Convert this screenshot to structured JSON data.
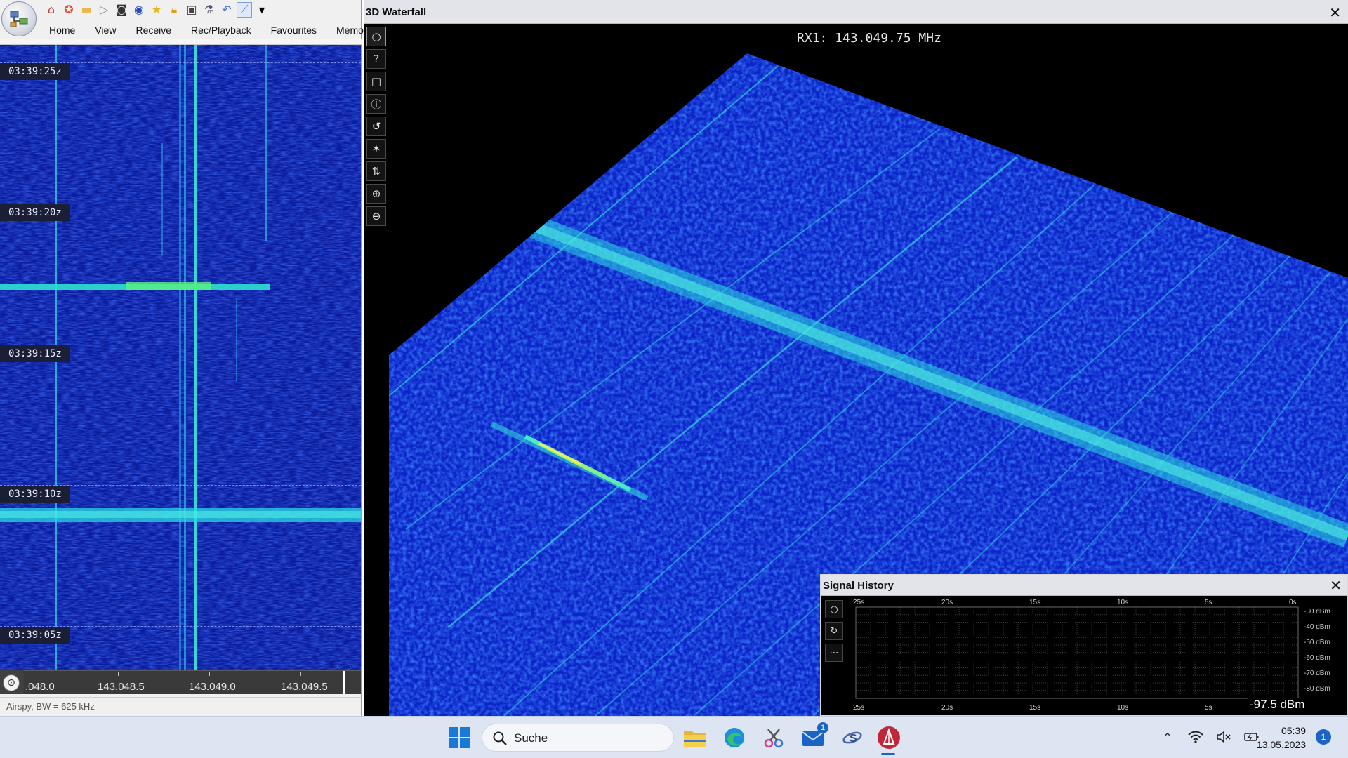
{
  "left_app": {
    "toolbar_icons": [
      "home-icon",
      "help-ring-icon",
      "folder-icon",
      "play-icon",
      "stop-icon",
      "record-icon",
      "favourite-star-icon",
      "lock-icon",
      "camera-icon",
      "flask-icon",
      "undo-icon",
      "chart-icon",
      "dropdown-icon"
    ],
    "ribbon_tabs": [
      "Home",
      "View",
      "Receive",
      "Rec/Playback",
      "Favourites",
      "Memor"
    ],
    "waterfall_times": [
      "03:39:25z",
      "03:39:20z",
      "03:39:15z",
      "03:39:10z",
      "03:39:05z"
    ],
    "freq_labels": [
      ".048.0",
      "143.048.5",
      "143.049.0",
      "143.049.5"
    ],
    "status": "Airspy, BW = 625 kHz"
  },
  "wf3d": {
    "title": "3D Waterfall",
    "close": "✕",
    "frequency": "RX1: 143.049.75 MHz",
    "tools": [
      "circle-icon",
      "help-icon",
      "square-icon",
      "info-icon",
      "rotate-icon",
      "sun-icon",
      "swap-vertical-icon",
      "zoom-in-icon",
      "zoom-out-icon"
    ],
    "tool_glyphs": [
      "○",
      "?",
      "□",
      "ⓘ",
      "↺",
      "✶",
      "⇅",
      "⊕",
      "⊖"
    ]
  },
  "signal_history": {
    "title": "Signal History",
    "close": "✕",
    "tools": [
      "○",
      "↻",
      "⋯"
    ],
    "time_labels": [
      "25s",
      "20s",
      "15s",
      "10s",
      "5s",
      "0s"
    ],
    "dbm_labels": [
      "-30 dBm",
      "-40 dBm",
      "-50 dBm",
      "-60 dBm",
      "-70 dBm",
      "-80 dBm"
    ],
    "readout": "-97.5 dBm"
  },
  "taskbar": {
    "search_placeholder": "Suche",
    "apps": [
      "file-explorer-icon",
      "edge-icon",
      "snipping-tool-icon",
      "mail-icon",
      "satellite-app-icon",
      "sdr-app-icon"
    ],
    "mail_badge": "1",
    "time": "05:39",
    "date": "13.05.2023",
    "notifications": "1"
  }
}
